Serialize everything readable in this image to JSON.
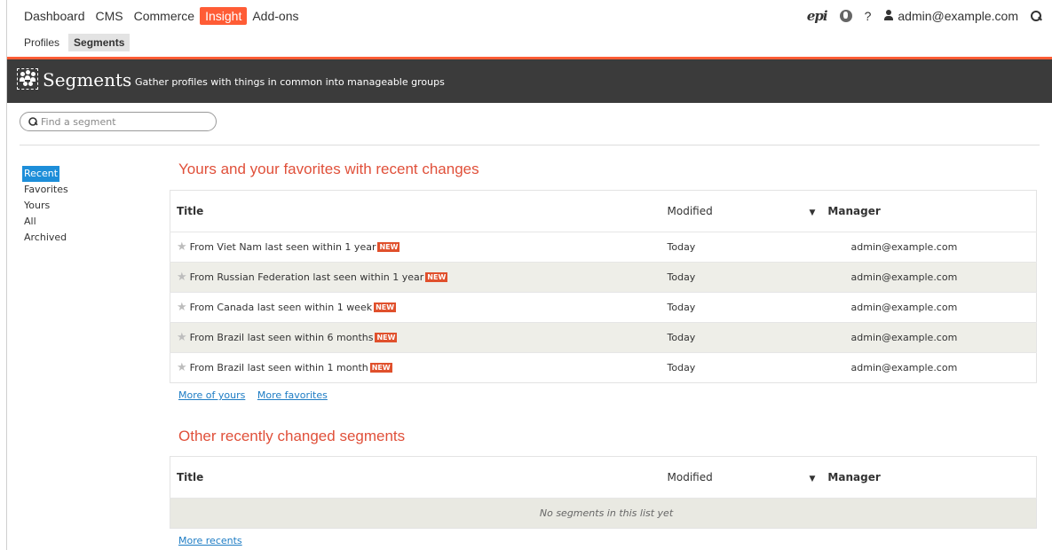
{
  "topnav": {
    "items": [
      {
        "label": "Dashboard",
        "active": false
      },
      {
        "label": "CMS",
        "active": false
      },
      {
        "label": "Commerce",
        "active": false
      },
      {
        "label": "Insight",
        "active": true
      },
      {
        "label": "Add-ons",
        "active": false
      }
    ],
    "logo": "epi",
    "help": "?",
    "user": "admin@example.com"
  },
  "subnav": {
    "items": [
      {
        "label": "Profiles",
        "active": false
      },
      {
        "label": "Segments",
        "active": true
      }
    ]
  },
  "header": {
    "title": "Segments",
    "subtitle": "Gather profiles with things in common into manageable groups"
  },
  "search": {
    "placeholder": "Find a segment",
    "value": ""
  },
  "leftnav": {
    "items": [
      {
        "label": "Recent",
        "active": true
      },
      {
        "label": "Favorites",
        "active": false
      },
      {
        "label": "Yours",
        "active": false
      },
      {
        "label": "All",
        "active": false
      },
      {
        "label": "Archived",
        "active": false
      }
    ]
  },
  "recent_section": {
    "title": "Yours and your favorites with recent changes",
    "columns": {
      "title": "Title",
      "modified": "Modified",
      "manager": "Manager"
    },
    "badge": "NEW",
    "rows": [
      {
        "title": "From Viet Nam last seen within 1 year",
        "modified": "Today",
        "manager": "admin@example.com"
      },
      {
        "title": "From Russian Federation last seen within 1 year",
        "modified": "Today",
        "manager": "admin@example.com"
      },
      {
        "title": "From Canada last seen within 1 week",
        "modified": "Today",
        "manager": "admin@example.com"
      },
      {
        "title": "From Brazil last seen within 6 months",
        "modified": "Today",
        "manager": "admin@example.com"
      },
      {
        "title": "From Brazil last seen within 1 month",
        "modified": "Today",
        "manager": "admin@example.com"
      }
    ],
    "links": [
      "More of yours",
      "More favorites"
    ]
  },
  "other_section": {
    "title": "Other recently changed segments",
    "columns": {
      "title": "Title",
      "modified": "Modified",
      "manager": "Manager"
    },
    "empty_text": "No segments in this list yet",
    "links": [
      "More recents"
    ]
  },
  "colors": {
    "accent": "#ff5c35",
    "header_band": "#3b3b3b",
    "section_title": "#e0503a",
    "link": "#1d7cc4",
    "active_nav": "#1d8ed9"
  }
}
